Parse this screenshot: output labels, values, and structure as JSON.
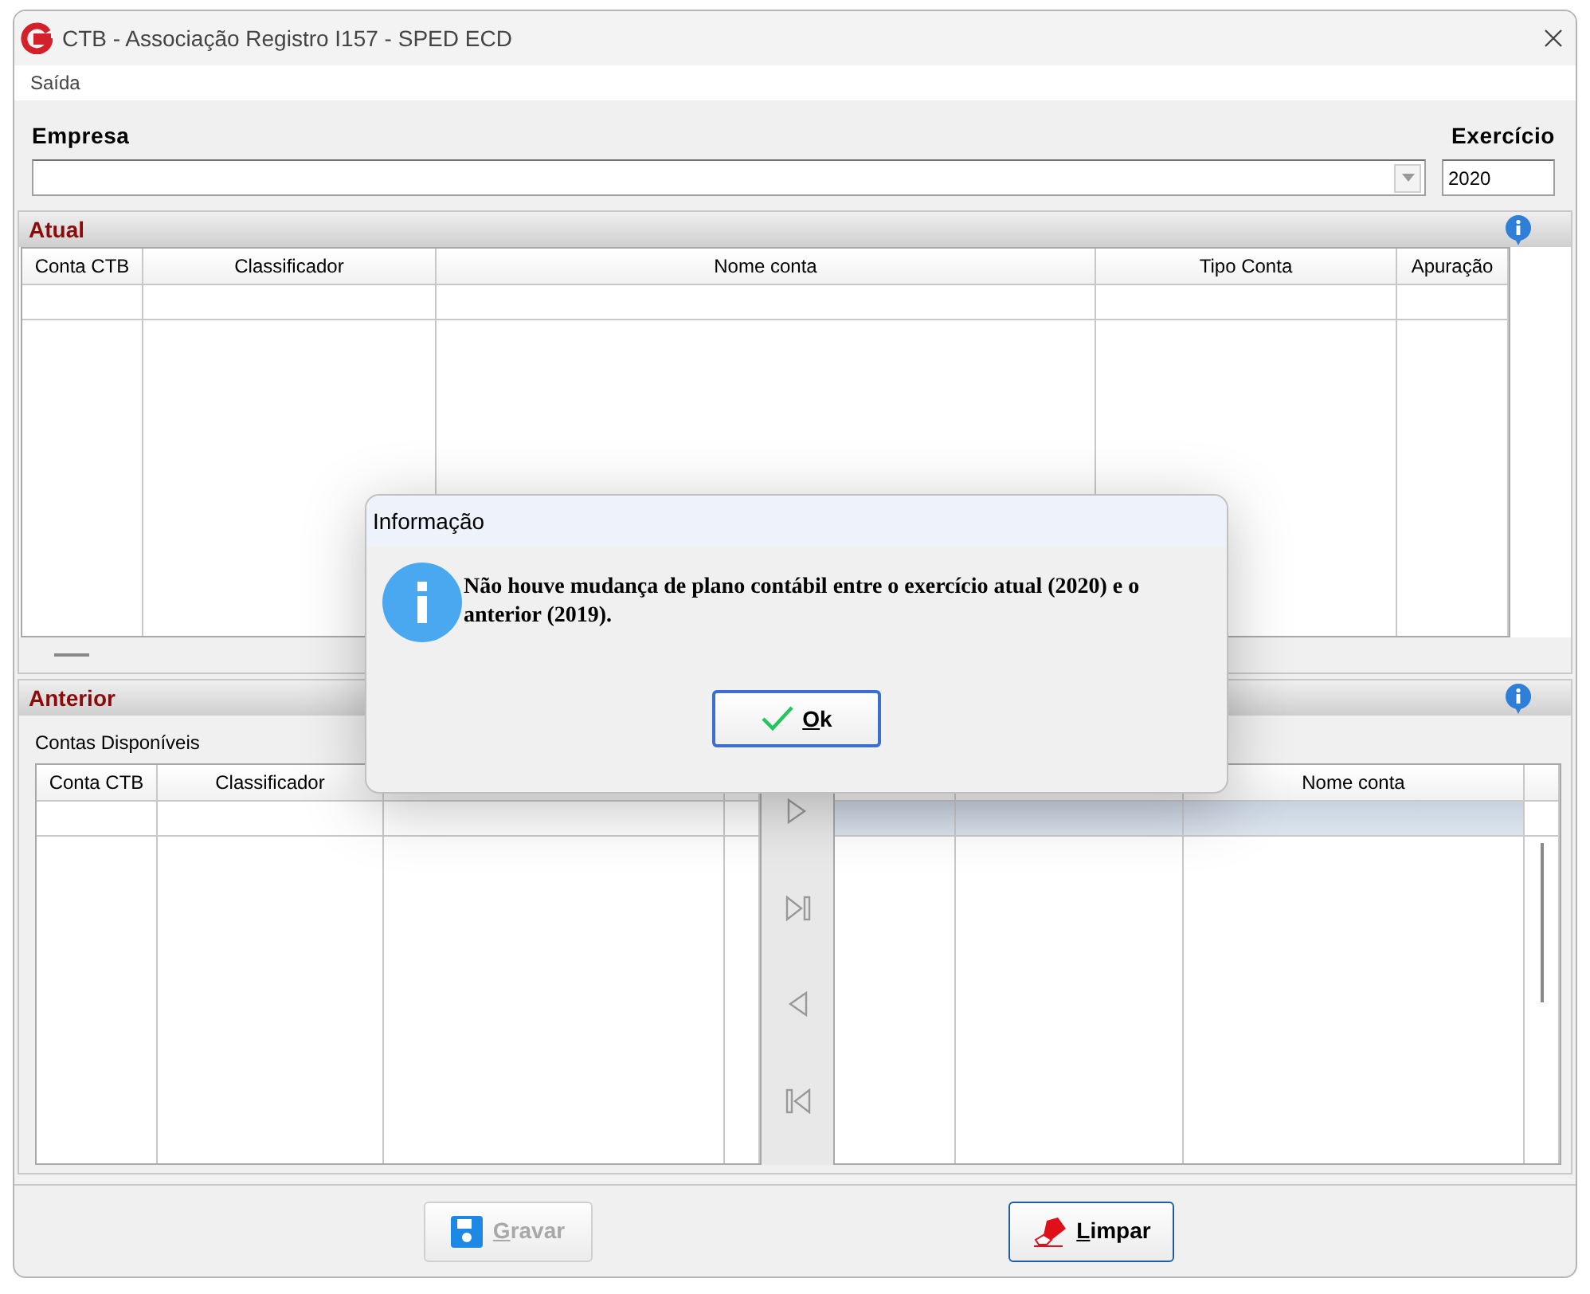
{
  "window": {
    "title": "CTB - Associação Registro I157 - SPED ECD"
  },
  "menu": [
    {
      "label": "Saída"
    }
  ],
  "empresa": {
    "label": "Empresa"
  },
  "exercicio": {
    "label": "Exercício",
    "value": "2020"
  },
  "atual": {
    "title": "Atual",
    "columns": [
      "Conta CTB",
      "Classificador",
      "Nome conta",
      "Tipo Conta",
      "Apuração"
    ],
    "rows": [
      {
        "selected": false
      }
    ]
  },
  "anterior": {
    "title": "Anterior",
    "available_label": "Contas Disponíveis",
    "left_grid": {
      "columns": [
        "Conta CTB",
        "Classificador"
      ],
      "rows": [
        {
          "selected": false
        }
      ]
    },
    "right_grid": {
      "columns": [
        "Nome conta"
      ],
      "rows": [
        {
          "selected": true
        }
      ]
    }
  },
  "buttons": [
    {
      "kind": "save",
      "label": "Gravar",
      "disabled": true
    },
    {
      "kind": "clear",
      "label": "Limpar",
      "disabled": false
    }
  ],
  "dialog": {
    "title": "Informação",
    "message": "Não houve mudança de plano contábil entre o exercício atual (2020) e o anterior (2019).",
    "button": "Ok"
  }
}
